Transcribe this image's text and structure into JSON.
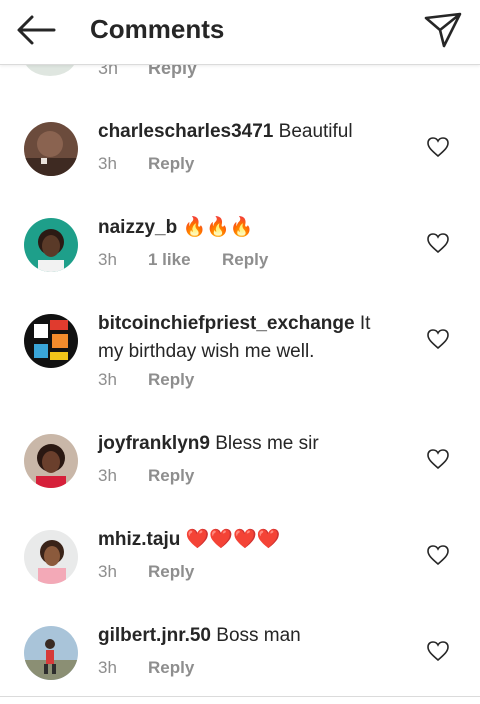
{
  "header": {
    "title": "Comments"
  },
  "partial": {
    "time": "3h",
    "reply": "Reply"
  },
  "comments": [
    {
      "username": "charlescharles3471",
      "text": "Beautiful",
      "time": "3h",
      "likes": "",
      "reply": "Reply"
    },
    {
      "username": "naizzy_b",
      "text": "🔥🔥🔥",
      "time": "3h",
      "likes": "1 like",
      "reply": "Reply"
    },
    {
      "username": "bitcoinchiefpriest_exchange",
      "text": "It my birthday wish me well.",
      "time": "3h",
      "likes": "",
      "reply": "Reply"
    },
    {
      "username": "joyfranklyn9",
      "text": "Bless me sir",
      "time": "3h",
      "likes": "",
      "reply": "Reply"
    },
    {
      "username": "mhiz.taju",
      "text": "❤️❤️❤️❤️",
      "time": "3h",
      "likes": "",
      "reply": "Reply"
    },
    {
      "username": "gilbert.jnr.50",
      "text": "Boss man",
      "time": "3h",
      "likes": "",
      "reply": "Reply"
    }
  ],
  "icons": {
    "back": "arrow-left-icon",
    "send": "direct-send-icon",
    "like": "heart-outline-icon"
  },
  "colors": {
    "username": "#262626",
    "meta": "#8e8e8e",
    "heart": "#262626",
    "fire": "#f5a623",
    "red-heart": "#e0182d"
  }
}
